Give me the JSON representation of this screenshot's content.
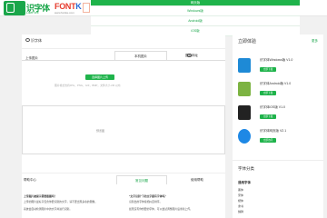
{
  "header": {
    "logo_text": "识字体",
    "logo_sub": "LikeFont",
    "fontk_brand_main": "FONT",
    "fontk_brand_k": "K",
    "fontk_sub": "www.fontke.com"
  },
  "dropdown": {
    "items": [
      {
        "label": "网页版",
        "active": true
      },
      {
        "label": "Windows版",
        "active": false
      },
      {
        "label": "Android版",
        "active": false
      },
      {
        "label": "iOS版",
        "active": false
      }
    ]
  },
  "main": {
    "tabs": {
      "my_font": "识字体"
    },
    "upload": {
      "section_label": "上传图片",
      "upload_tab": "本机图片",
      "url_tab": "图片网址",
      "choose_button": "选择图片上传",
      "hint": "图片格式支持JPG，PNG，GIF，BMP，文件大小 2M 以内",
      "preview_label": "预览图"
    },
    "help": {
      "title": "帮助中心",
      "tab_active": "常见问题",
      "tab_inactive": "使用帮助",
      "left_lines": [
        "上传图片被提示需要截图吗？",
        "上传的图片最好只包含你要识别的文字，请不要出现多余的图像。",
        "系统会自动检测图片中的文字并进行识别。"
      ],
      "right_lines": [
        "“文字识别”下的文字都有字体吗？",
        "识别出的字体按相似度排序。",
        "如果没有你想要的字体，可以尝试调整图片后重新上传。"
      ]
    }
  },
  "sidebar": {
    "title": "立即体验",
    "more_label": "更多",
    "apps": [
      {
        "name": "识字体Windows版 V1.0",
        "button": "立即下载",
        "color": "#1e8ad6"
      },
      {
        "name": "识字体Android版 V1.0",
        "button": "立即下载",
        "color": "#7cb342"
      },
      {
        "name": "识字体iOS版 V1.0",
        "button": "立即下载",
        "color": "#222222"
      },
      {
        "name": "识字体网页版 V2.1",
        "button": "立即访问",
        "color": "#1e88e5"
      }
    ]
  },
  "categories": {
    "title": "字体分类",
    "group_title": "通用字体",
    "items": [
      "黑体",
      "宋体",
      "楷体",
      "隶书",
      "魏碑"
    ]
  },
  "colors": {
    "accent": "#1fb34b",
    "text": "#333333",
    "background": "#f1f1f1"
  }
}
